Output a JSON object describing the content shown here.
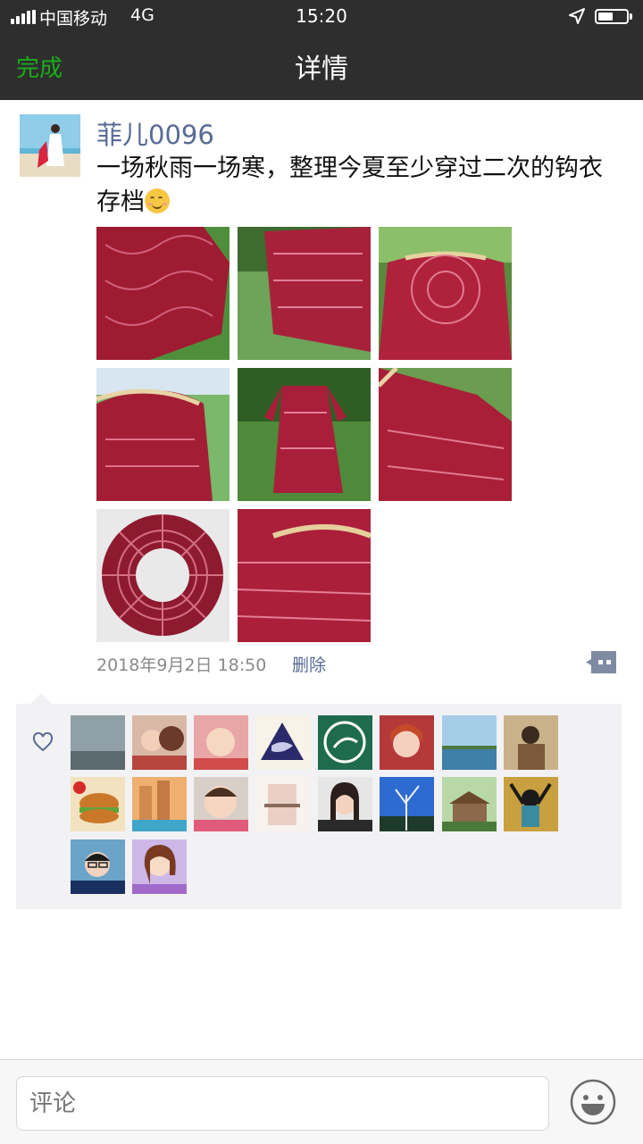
{
  "status_bar": {
    "carrier": "中国移动",
    "network": "4G",
    "time": "15:20"
  },
  "nav": {
    "done_label": "完成",
    "title": "详情"
  },
  "post": {
    "author": "菲儿0096",
    "text": "一场秋雨一场寒，整理今夏至少穿过二次的钩衣存档",
    "emoji_icon": "smiling-face-icon",
    "photo_count": 8,
    "timestamp": "2018年9月2日 18:50",
    "delete_label": "删除"
  },
  "likes": {
    "icon": "heart-outline-icon",
    "liker_count": 18
  },
  "comment": {
    "placeholder": "评论",
    "emoji_icon": "emoji-face-icon"
  },
  "colors": {
    "nav_bg": "#2e2e2e",
    "accent_green": "#1aad19",
    "link_blue": "#576b95",
    "panel_bg": "#f2f2f4"
  }
}
